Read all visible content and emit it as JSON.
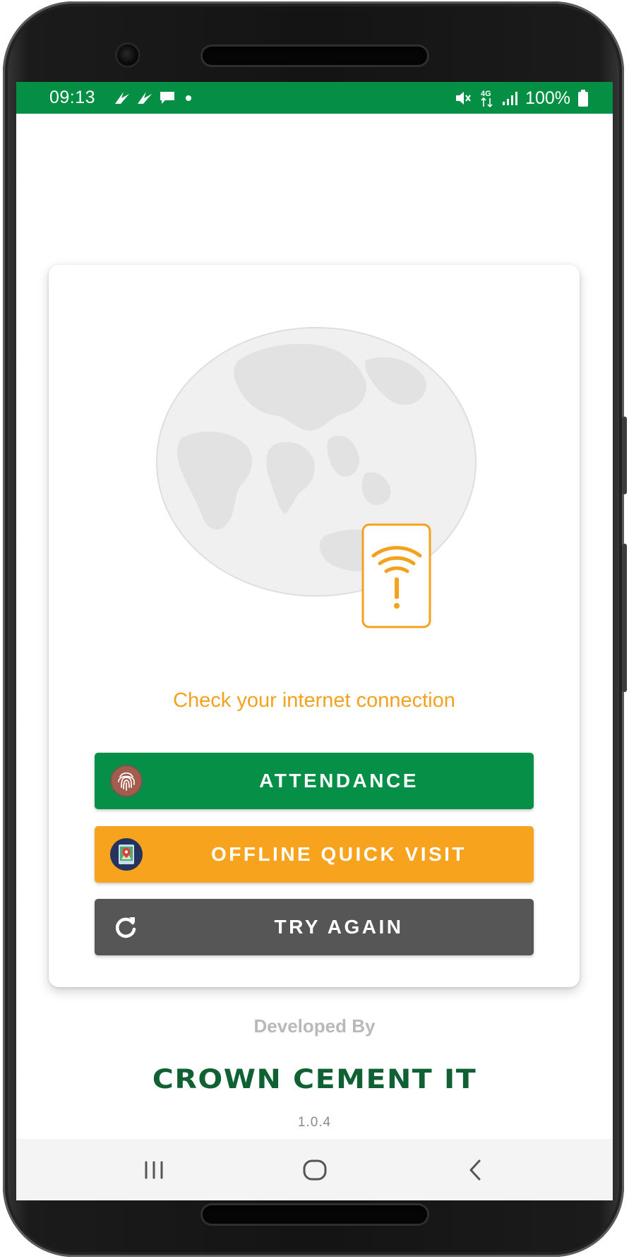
{
  "status_bar": {
    "time": "09:13",
    "battery_text": "100%",
    "network_label": "4G",
    "notification_icons": [
      "swoosh-icon",
      "swoosh-icon",
      "chat-icon",
      "dot-icon"
    ],
    "status_icons": [
      "mute-vibrate-icon",
      "network-4g-icon",
      "signal-icon",
      "battery-icon"
    ]
  },
  "card": {
    "illustration_icon": "globe-wifi-warning-icon",
    "message": "Check your internet connection",
    "buttons": [
      {
        "label": "ATTENDANCE",
        "icon": "fingerprint-icon",
        "color": "#068f46"
      },
      {
        "label": "OFFLINE QUICK VISIT",
        "icon": "map-location-icon",
        "color": "#f7a31d"
      },
      {
        "label": "TRY AGAIN",
        "icon": "refresh-icon",
        "color": "#565656"
      }
    ]
  },
  "footer": {
    "developed_by": "Developed By",
    "company": "CROWN CEMENT IT",
    "version": "1.0.4"
  },
  "nav": {
    "recent_icon": "recent-apps-icon",
    "home_icon": "home-icon",
    "back_icon": "back-icon"
  },
  "colors": {
    "brand_green": "#058f45",
    "accent_orange": "#f4a21e",
    "company_green": "#0f6133"
  }
}
